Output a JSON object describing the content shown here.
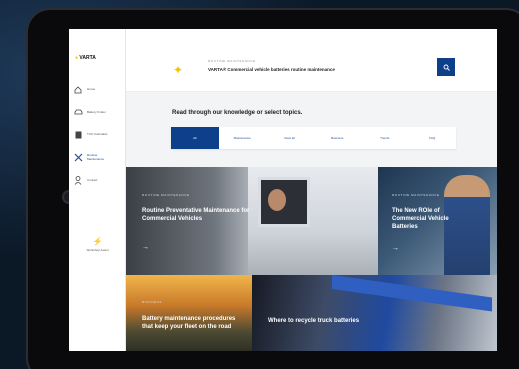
{
  "app": {
    "brand": "VARTA",
    "brand_dot": "●"
  },
  "sidebar": {
    "items": [
      {
        "label": "Home",
        "icon": "home-icon"
      },
      {
        "label": "Battery Finder",
        "icon": "car-icon"
      },
      {
        "label": "TCO Calculator",
        "icon": "calculator-icon"
      },
      {
        "label": "Routine Maintenance",
        "icon": "tools-icon",
        "active": true
      },
      {
        "label": "Contact",
        "icon": "user-icon"
      }
    ],
    "assistant_label": "Workshop Assist"
  },
  "header": {
    "eyebrow": "ROUTINE MAINTENANCE",
    "title": "VARTA® Commercial vehicle batteries routine maintenance"
  },
  "filter": {
    "heading": "Read through our knowledge or select topics.",
    "tabs": [
      "All",
      "Maintenance",
      "Fleet kit",
      "Business",
      "Trends",
      "FAQ"
    ],
    "selected": 0
  },
  "tiles": [
    {
      "eyebrow": "ROUTINE MAINTENANCE",
      "title": "Routine Preventative Maintenance for Commercial Vehicles"
    },
    {
      "eyebrow": "ROUTINE MAINTENANCE",
      "title": "The New ROle of Commercial Vehicle Batteries"
    },
    {
      "eyebrow": "BUSINESS",
      "title": "Battery maintenance procedures that keep your fleet on the road"
    },
    {
      "eyebrow": "",
      "title": "Where to recycle truck batteries"
    }
  ],
  "colors": {
    "accent": "#0d3f8a",
    "brand_yellow": "#f5c400"
  }
}
